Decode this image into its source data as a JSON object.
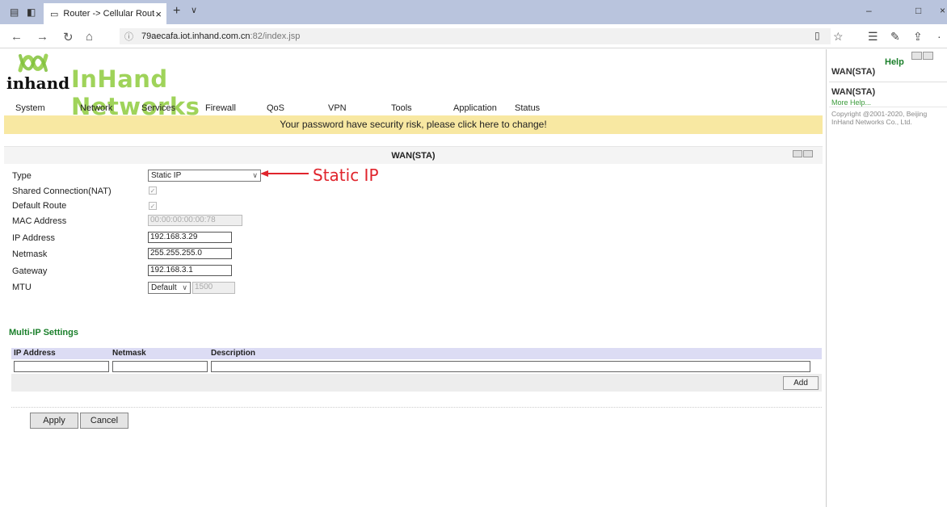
{
  "browser": {
    "tab_title": "Router -> Cellular Route",
    "tab_close": "×",
    "new_tab": "+",
    "tab_menu": "∨",
    "url_host": "79aecafa.iot.inhand.com.cn",
    "url_path": ":82/index.jsp",
    "minimize": "–",
    "maximize": "□",
    "close": "×"
  },
  "logo": {
    "inhand_text": "inhand",
    "brand_text": "InHand Networks",
    "brand_color": "#9fd35a"
  },
  "menu": [
    "System",
    "Network",
    "Services",
    "Firewall",
    "QoS",
    "VPN",
    "Tools",
    "Application",
    "Status"
  ],
  "warning": "Your password have security risk, please click here to change!",
  "section_title": "WAN(STA)",
  "form": {
    "type_label": "Type",
    "type_value": "Static IP",
    "nat_label": "Shared Connection(NAT)",
    "default_route_label": "Default Route",
    "mac_label": "MAC Address",
    "mac_value": "00:00:00:00:00:78",
    "ip_label": "IP Address",
    "ip_value": "192.168.3.29",
    "netmask_label": "Netmask",
    "netmask_value": "255.255.255.0",
    "gateway_label": "Gateway",
    "gateway_value": "192.168.3.1",
    "mtu_label": "MTU",
    "mtu_mode": "Default",
    "mtu_value": "1500"
  },
  "annotation": "Static IP",
  "multi_ip": {
    "title": "Multi-IP Settings",
    "col_ip": "IP Address",
    "col_netmask": "Netmask",
    "col_description": "Description",
    "add_label": "Add"
  },
  "buttons": {
    "apply": "Apply",
    "cancel": "Cancel"
  },
  "help": {
    "title": "Help",
    "heading1": "WAN(STA)",
    "heading2": "WAN(STA)",
    "more": "More Help...",
    "copyright": "Copyright @2001-2020, Beijing InHand Networks Co., Ltd."
  }
}
